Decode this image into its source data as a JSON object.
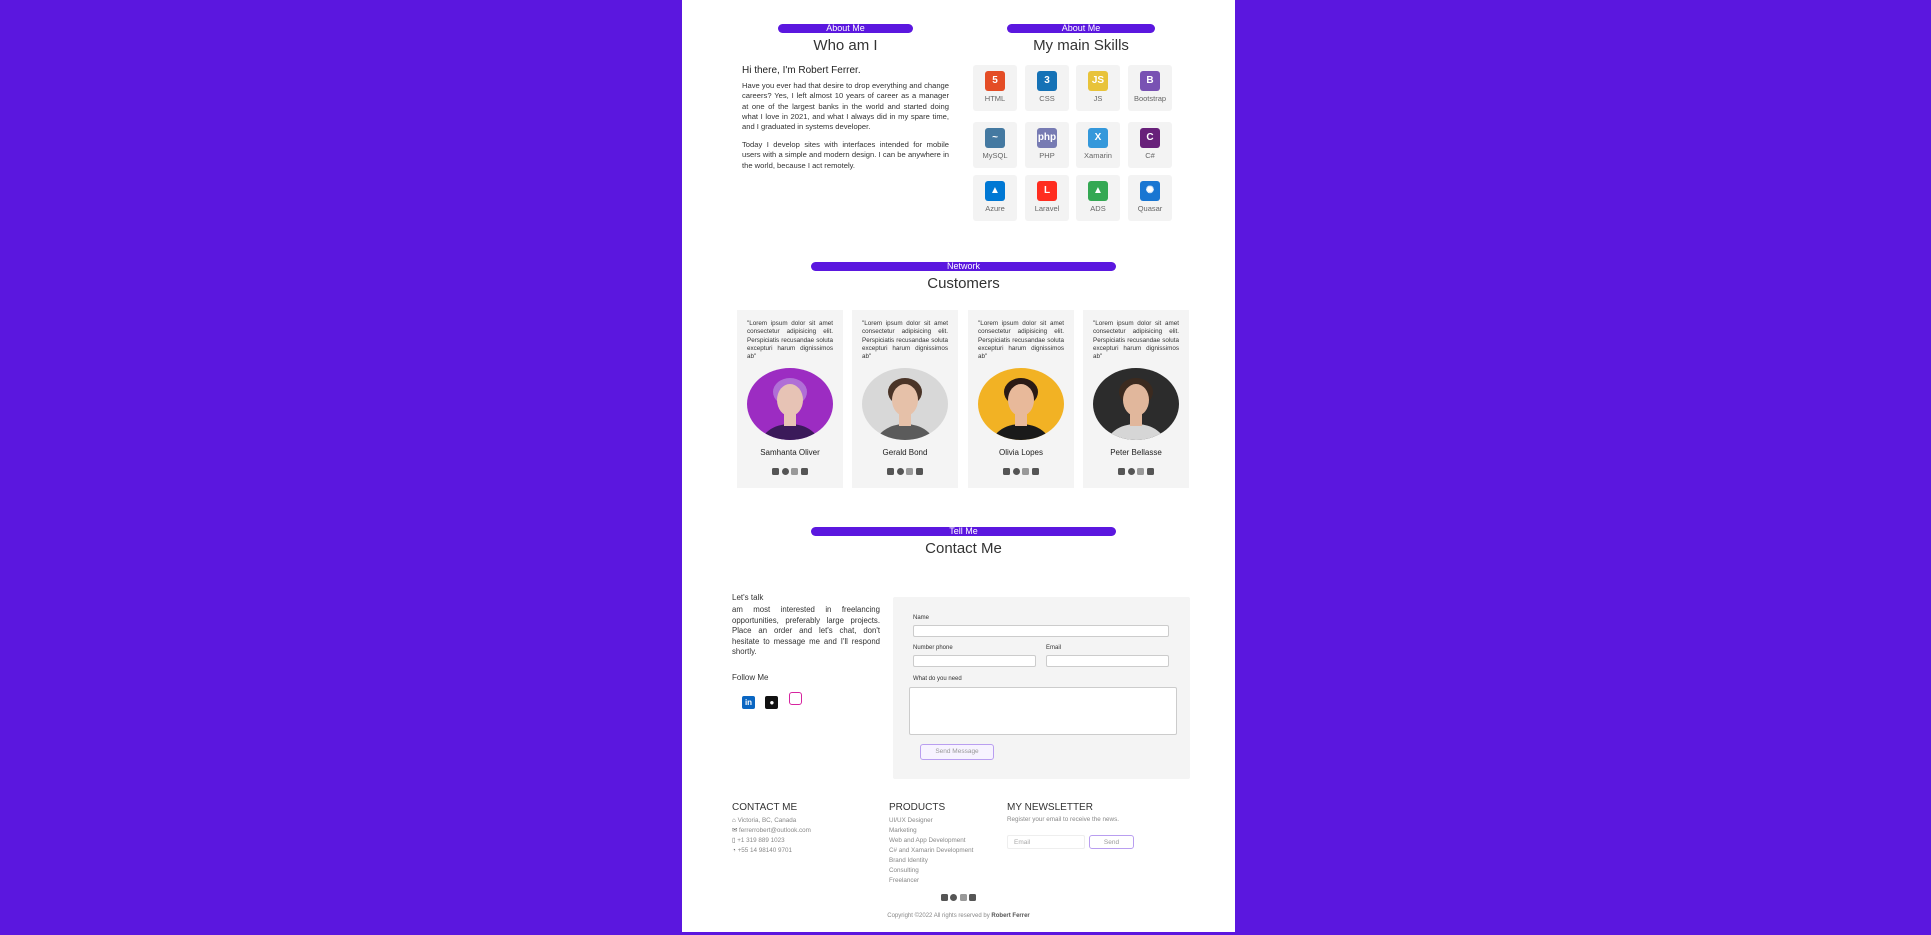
{
  "about": {
    "badge": "About Me",
    "title": "Who am I",
    "hello": "Hi there, I'm Robert Ferrer.",
    "paragraph1": "Have you ever had that desire to drop everything and change careers? Yes, I left almost 10 years of career as a manager at one of the largest banks in the world and started doing what I love in 2021, and what I always did in my spare time, and I graduated in systems developer.",
    "paragraph2": "Today I develop sites with interfaces intended for mobile users with a simple and modern design. I can be anywhere in the world, because I act remotely."
  },
  "skills": {
    "badge": "About Me",
    "title": "My main Skills",
    "items": [
      {
        "label": "HTML",
        "icon": "html5-icon",
        "color": "#e44d26",
        "glyph": "5"
      },
      {
        "label": "CSS",
        "icon": "css3-icon",
        "color": "#1572b6",
        "glyph": "3"
      },
      {
        "label": "JS",
        "icon": "javascript-icon",
        "color": "#e8c33a",
        "glyph": "JS"
      },
      {
        "label": "Bootstrap",
        "icon": "bootstrap-icon",
        "color": "#7952b3",
        "glyph": "B"
      },
      {
        "label": "MySQL",
        "icon": "mysql-icon",
        "color": "#4479a1",
        "glyph": "~"
      },
      {
        "label": "PHP",
        "icon": "php-icon",
        "color": "#777bb3",
        "glyph": "php"
      },
      {
        "label": "Xamarin",
        "icon": "xamarin-icon",
        "color": "#3498db",
        "glyph": "X"
      },
      {
        "label": "C#",
        "icon": "csharp-icon",
        "color": "#68217a",
        "glyph": "C"
      },
      {
        "label": "Azure",
        "icon": "azure-icon",
        "color": "#0078d4",
        "glyph": "▲"
      },
      {
        "label": "Laravel",
        "icon": "laravel-icon",
        "color": "#ff2d20",
        "glyph": "L"
      },
      {
        "label": "ADS",
        "icon": "google-ads-icon",
        "color": "#34a853",
        "glyph": "▲"
      },
      {
        "label": "Quasar",
        "icon": "quasar-icon",
        "color": "#1976d2",
        "glyph": "✺"
      }
    ]
  },
  "customers": {
    "badge": "Network",
    "title": "Customers",
    "items": [
      {
        "quote": "\"Lorem ipsum dolor sit amet consectetur adipisicing elit. Perspiciatis recusandae soluta excepturi harum dignissimos ab\"",
        "name": "Samhanta Oliver",
        "photo": "woman-purple-hair-photo",
        "bg": "#9c2cc2",
        "skin": "#e7c3b5",
        "hair": "#b06fd6",
        "shirt": "#3b1a5a"
      },
      {
        "quote": "\"Lorem ipsum dolor sit amet consectetur adipisicing elit. Perspiciatis recusandae soluta excepturi harum dignissimos ab\"",
        "name": "Gerald Bond",
        "photo": "man-scarf-photo",
        "bg": "#d8d8d8",
        "skin": "#e6c1a9",
        "hair": "#4a3427",
        "shirt": "#5b5b5b"
      },
      {
        "quote": "\"Lorem ipsum dolor sit amet consectetur adipisicing elit. Perspiciatis recusandae soluta excepturi harum dignissimos ab\"",
        "name": "Olivia Lopes",
        "photo": "woman-yellow-bg-photo",
        "bg": "#f2b224",
        "skin": "#e8b99a",
        "hair": "#2a1a15",
        "shirt": "#1a1a1a"
      },
      {
        "quote": "\"Lorem ipsum dolor sit amet consectetur adipisicing elit. Perspiciatis recusandae soluta excepturi harum dignissimos ab\"",
        "name": "Peter Bellasse",
        "photo": "man-dark-bg-photo",
        "bg": "#2c2c2c",
        "skin": "#e1b79c",
        "hair": "#3b2a1f",
        "shirt": "#d6d6d6"
      }
    ]
  },
  "contact": {
    "badge": "Tell Me",
    "title": "Contact Me",
    "lets_talk": "Let's talk",
    "blurb": "am most interested in freelancing opportunities, preferably large projects. Place an order and let's chat, don't hesitate to message me and I'll respond shortly.",
    "follow": "Follow Me",
    "form": {
      "name_label": "Name",
      "phone_label": "Number phone",
      "email_label": "Email",
      "need_label": "What do you need",
      "submit": "Send Message"
    }
  },
  "footer": {
    "contact_title": "CONTACT ME",
    "contact_items": [
      "Victoria, BC, Canada",
      "ferrerrobert@outlook.com",
      "+1 319 889 1023",
      "+55 14 98140 9701"
    ],
    "products_title": "PRODUCTS",
    "products": [
      "UI/UX Designer",
      "Marketing",
      "Web and App Development",
      "C# and Xamarin Development",
      "Brand Identity",
      "Consulting",
      "Freelancer"
    ],
    "newsletter_title": "MY NEWSLETTER",
    "newsletter_text": "Register your email to receive the news.",
    "newsletter_placeholder": "Email",
    "newsletter_button": "Send",
    "copyright": "Copyright ©2022 All rights reserved by",
    "copyright_name": "Robert Ferrer"
  },
  "colors": {
    "accent": "#5b17df",
    "background": "#5b17df"
  }
}
